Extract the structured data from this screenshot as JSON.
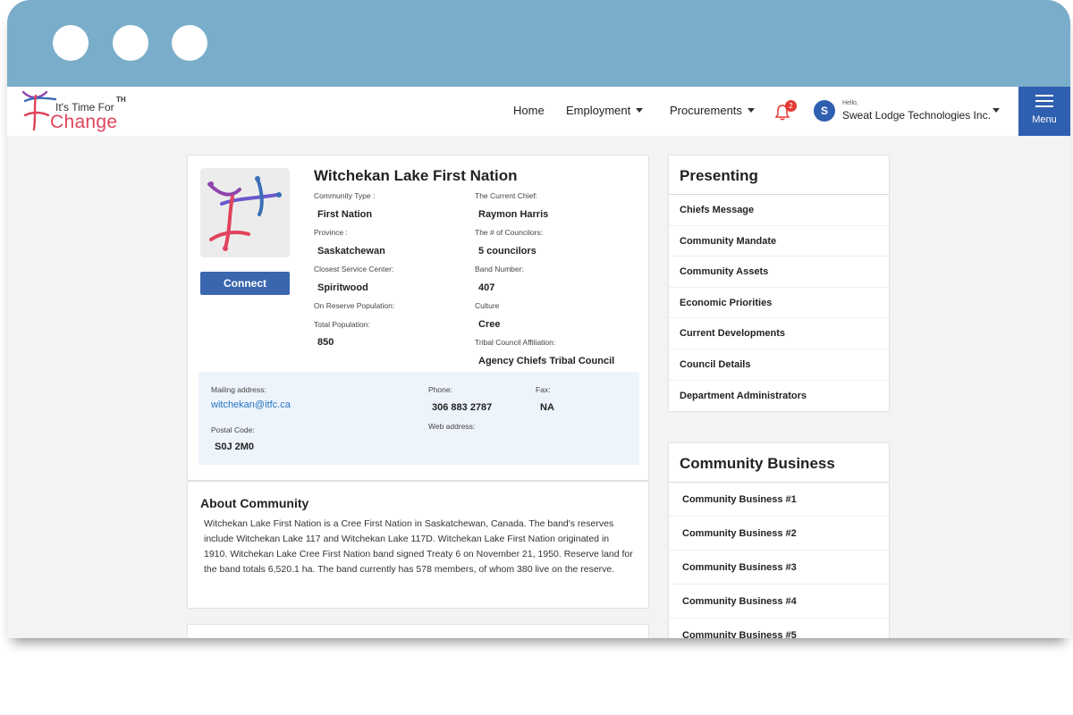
{
  "brand": {
    "line1": "It's Time For",
    "tm": "TH",
    "line2": "Change"
  },
  "nav": {
    "home": "Home",
    "employment": "Employment",
    "procurements": "Procurements",
    "notification_count": "2",
    "avatar_initial": "S",
    "greeting": "Hello,",
    "user_name": "Sweat Lodge Technologies Inc.",
    "menu_label": "Menu"
  },
  "community": {
    "name": "Witchekan Lake First Nation",
    "connect_label": "Connect",
    "fields": {
      "community_type": {
        "label": "Community Type :",
        "value": "First Nation"
      },
      "province": {
        "label": "Province :",
        "value": "Saskatchewan"
      },
      "closest_service_center": {
        "label": "Closest Service Center:",
        "value": "Spiritwood"
      },
      "on_reserve_population": {
        "label": "On Reserve Population:",
        "value": ""
      },
      "total_population": {
        "label": "Total Population:",
        "value": "850"
      },
      "current_chief": {
        "label": "The Current Chief:",
        "value": "Raymon Harris"
      },
      "councilors": {
        "label": "The # of Councilors:",
        "value": "5 councilors"
      },
      "band_number": {
        "label": "Band Number:",
        "value": "407"
      },
      "culture": {
        "label": "Culture",
        "value": "Cree"
      },
      "tribal_council": {
        "label": "Tribal Council Affiliation:",
        "value": "Agency Chiefs Tribal Council"
      }
    },
    "contact": {
      "mailing_address": {
        "label": "Mailing address:",
        "value": "witchekan@itfc.ca"
      },
      "postal_code": {
        "label": "Postal Code:",
        "value": "S0J 2M0"
      },
      "phone": {
        "label": "Phone:",
        "value": "306 883 2787"
      },
      "fax": {
        "label": "Fax:",
        "value": "NA"
      },
      "web_address": {
        "label": "Web address:",
        "value": ""
      }
    }
  },
  "about": {
    "title": "About Community",
    "text": "Witchekan Lake First Nation is a Cree First Nation in Saskatchewan, Canada. The band's reserves include Witchekan Lake 117 and Witchekan Lake 117D. Witchekan Lake First Nation originated in 1910. Witchekan Lake Cree First Nation band signed Treaty 6 on November 21, 1950. Reserve land for the band totals 6,520.1 ha. The band currently has 578 members, of whom 380 live on the reserve."
  },
  "presenting": {
    "title": "Presenting",
    "items": [
      "Chiefs Message",
      "Community Mandate",
      "Community Assets",
      "Economic Priorities",
      "Current Developments",
      "Council Details",
      "Department Administrators"
    ]
  },
  "business": {
    "title": "Community Business",
    "items": [
      "Community Business #1",
      "Community Business #2",
      "Community Business #3",
      "Community Business #4",
      "Community Business #5"
    ]
  },
  "colors": {
    "titlebar": "#7aadca",
    "accent_blue": "#2f5fb0",
    "brand_pink": "#e0435b",
    "badge_red": "#e53935",
    "contact_bg": "#eef4fb"
  }
}
